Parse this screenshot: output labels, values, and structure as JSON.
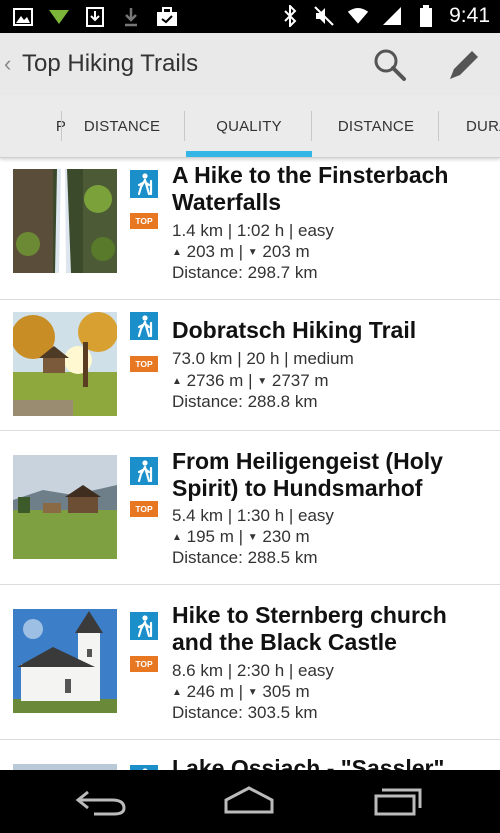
{
  "status": {
    "time": "9:41"
  },
  "header": {
    "title": "Top Hiking Trails"
  },
  "tabs": [
    {
      "label": "P"
    },
    {
      "label": "DISTANCE"
    },
    {
      "label": "QUALITY"
    },
    {
      "label": "DISTANCE"
    },
    {
      "label": "DURA"
    }
  ],
  "badge_label": "TOP",
  "trails": [
    {
      "title": "A Hike to the Finsterbach Waterfalls",
      "stats": "1.4 km | 1:02 h | easy",
      "ascent": "203 m",
      "descent": "203 m",
      "distance": "Distance: 298.7 km"
    },
    {
      "title": "Dobratsch Hiking Trail",
      "stats": "73.0 km | 20 h | medium",
      "ascent": "2736 m",
      "descent": "2737 m",
      "distance": "Distance: 288.8 km"
    },
    {
      "title": "From Heiligengeist (Holy Spirit) to Hundsmarhof",
      "stats": "5.4 km | 1:30 h | easy",
      "ascent": "195 m",
      "descent": "230 m",
      "distance": "Distance: 288.5 km"
    },
    {
      "title": "Hike to Sternberg church and the Black Castle",
      "stats": "8.6 km | 2:30 h | easy",
      "ascent": "246 m",
      "descent": "305 m",
      "distance": "Distance: 303.5 km"
    },
    {
      "title": "Lake Ossiach - \"Sassler\""
    }
  ],
  "colors": {
    "accent": "#33b5e5",
    "hike_icon": "#1a8fc9",
    "top_badge": "#e87722"
  }
}
